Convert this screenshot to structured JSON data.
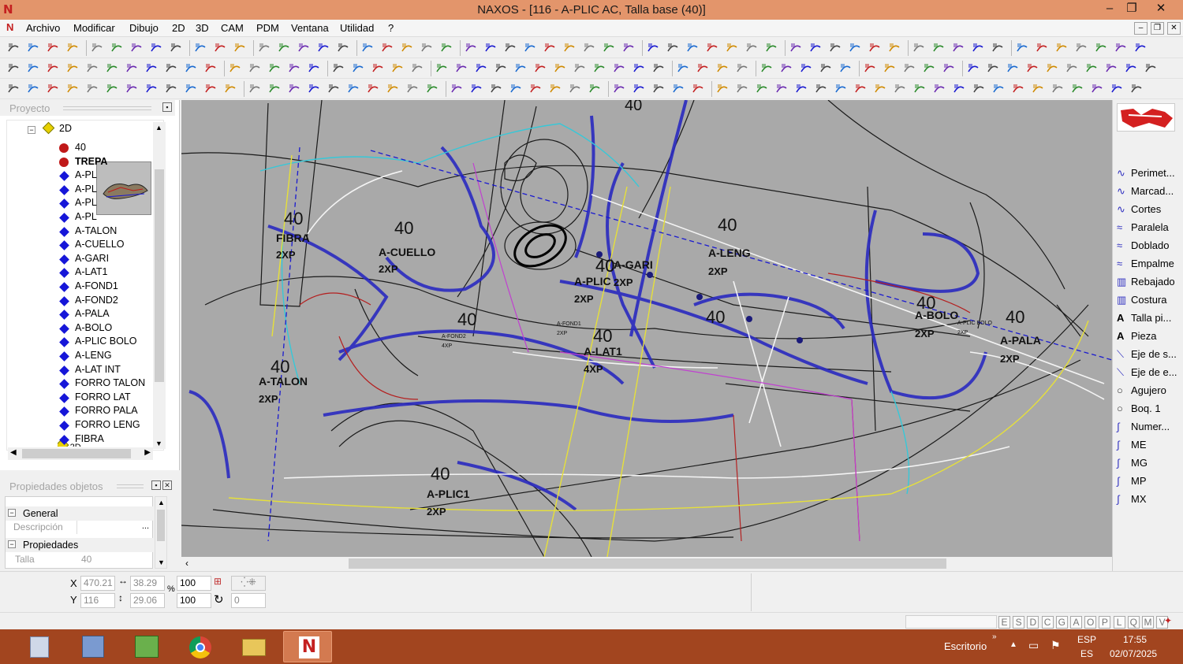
{
  "window": {
    "title": "NAXOS - [116 - A-PLIC AC, Talla base (40)]",
    "app_icon": "N",
    "controls": {
      "minimize": "–",
      "maximize": "❐",
      "close": "✕"
    }
  },
  "menu": {
    "items": [
      "Archivo",
      "Modificar",
      "Dibujo",
      "2D",
      "3D",
      "CAM",
      "PDM",
      "Ventana",
      "Utilidad",
      "?"
    ]
  },
  "project_panel": {
    "header": "Proyecto",
    "tree_root": "2D",
    "items": [
      {
        "label": "40",
        "icon": "red-circle"
      },
      {
        "label": "TREPA",
        "icon": "red-circle",
        "bold": true
      },
      {
        "label": "A-PL",
        "icon": "blue-diamond"
      },
      {
        "label": "A-PL",
        "icon": "blue-diamond"
      },
      {
        "label": "A-PL",
        "icon": "blue-diamond"
      },
      {
        "label": "A-PL",
        "icon": "blue-diamond"
      },
      {
        "label": "A-TALON",
        "icon": "blue-diamond"
      },
      {
        "label": "A-CUELLO",
        "icon": "blue-diamond"
      },
      {
        "label": "A-GARI",
        "icon": "blue-diamond"
      },
      {
        "label": "A-LAT1",
        "icon": "blue-diamond"
      },
      {
        "label": "A-FOND1",
        "icon": "blue-diamond"
      },
      {
        "label": "A-FOND2",
        "icon": "blue-diamond"
      },
      {
        "label": "A-PALA",
        "icon": "blue-diamond"
      },
      {
        "label": "A-BOLO",
        "icon": "blue-diamond"
      },
      {
        "label": "A-PLIC BOLO",
        "icon": "blue-diamond"
      },
      {
        "label": "A-LENG",
        "icon": "blue-diamond"
      },
      {
        "label": "A-LAT INT",
        "icon": "blue-diamond"
      },
      {
        "label": "FORRO TALON",
        "icon": "blue-diamond"
      },
      {
        "label": "FORRO LAT",
        "icon": "blue-diamond"
      },
      {
        "label": "FORRO PALA",
        "icon": "blue-diamond"
      },
      {
        "label": "FORRO LENG",
        "icon": "blue-diamond"
      },
      {
        "label": "FIBRA",
        "icon": "blue-diamond"
      }
    ],
    "cut_off_item": "2D"
  },
  "properties_panel": {
    "header": "Propiedades objetos",
    "sections": [
      {
        "title": "General",
        "rows": [
          {
            "label": "Descripción",
            "value": ""
          }
        ]
      },
      {
        "title": "Propiedades",
        "rows": [
          {
            "label": "Talla",
            "value": "40"
          }
        ]
      }
    ]
  },
  "canvas": {
    "pieces": [
      {
        "size": "40",
        "name": "FIBRA",
        "qty": "2XP"
      },
      {
        "size": "40",
        "name": "A-CUELLO",
        "qty": "2XP"
      },
      {
        "size": "40",
        "name": "A-LENG",
        "qty": "2XP"
      },
      {
        "size": "40",
        "name": "A-GARI",
        "qty": "2XP"
      },
      {
        "size": "40",
        "name": "A-PLIC",
        "qty": "2XP"
      },
      {
        "size": "40",
        "name": "A-BOLO",
        "qty": "2XP"
      },
      {
        "size": "40",
        "name": "A-PALA",
        "qty": "2XP"
      },
      {
        "size": "40",
        "name": "A-LAT1",
        "qty": "4XP"
      },
      {
        "size": "40",
        "name": "A-TALON",
        "qty": "2XP"
      },
      {
        "size": "40",
        "name": "A-PLIC1",
        "qty": "2XP"
      },
      {
        "size": "40",
        "name": "",
        "qty": ""
      },
      {
        "size": "40",
        "name": "",
        "qty": ""
      }
    ],
    "small_labels": [
      "A-FOND2",
      "4XP",
      "A-FOND1",
      "2XP",
      "A-PLIC BOLO",
      "2XP"
    ],
    "top_label": "40"
  },
  "right_panel": {
    "items": [
      {
        "label": "Perimet...",
        "icon": "curve-icon"
      },
      {
        "label": "Marcad...",
        "icon": "curve-icon"
      },
      {
        "label": "Cortes",
        "icon": "curve-icon"
      },
      {
        "label": "Paralela",
        "icon": "parallel-icon"
      },
      {
        "label": "Doblado",
        "icon": "parallel-icon"
      },
      {
        "label": "Empalme",
        "icon": "parallel-icon"
      },
      {
        "label": "Rebajado",
        "icon": "hatch-icon"
      },
      {
        "label": "Costura",
        "icon": "hatch-icon"
      },
      {
        "label": "Talla pi...",
        "icon": "text-icon"
      },
      {
        "label": "Pieza",
        "icon": "text-icon"
      },
      {
        "label": "Eje de s...",
        "icon": "axis-icon"
      },
      {
        "label": "Eje de e...",
        "icon": "axis-icon"
      },
      {
        "label": "Agujero",
        "icon": "circle-icon"
      },
      {
        "label": "Boq. 1",
        "icon": "circle-icon"
      },
      {
        "label": "Numer...",
        "icon": "numbering-icon"
      },
      {
        "label": "ME",
        "icon": "numbering-icon"
      },
      {
        "label": "MG",
        "icon": "numbering-icon"
      },
      {
        "label": "MP",
        "icon": "numbering-icon"
      },
      {
        "label": "MX",
        "icon": "numbering-icon"
      }
    ]
  },
  "coords": {
    "x_label": "X",
    "y_label": "Y",
    "x": "470.21",
    "y": "116",
    "dx": "38.29",
    "dy": "29.06",
    "pct_symbol": "%",
    "scale_x": "100",
    "scale_y": "100",
    "angle": "0"
  },
  "status": {
    "letters": [
      "E",
      "S",
      "D",
      "C",
      "G",
      "A",
      "O",
      "P",
      "L",
      "Q",
      "M",
      "V"
    ]
  },
  "taskbar": {
    "desktop_label": "Escritorio",
    "lang_top": "ESP",
    "lang_bottom": "ES",
    "time": "17:55",
    "date": "02/07/2025"
  },
  "colors": {
    "title_bar": "#e3956b",
    "canvas_bg": "#a9a9a9",
    "taskbar": "#a2451f",
    "piece_blue": "#2a2ac0",
    "diamond_blue": "#1616d8"
  }
}
